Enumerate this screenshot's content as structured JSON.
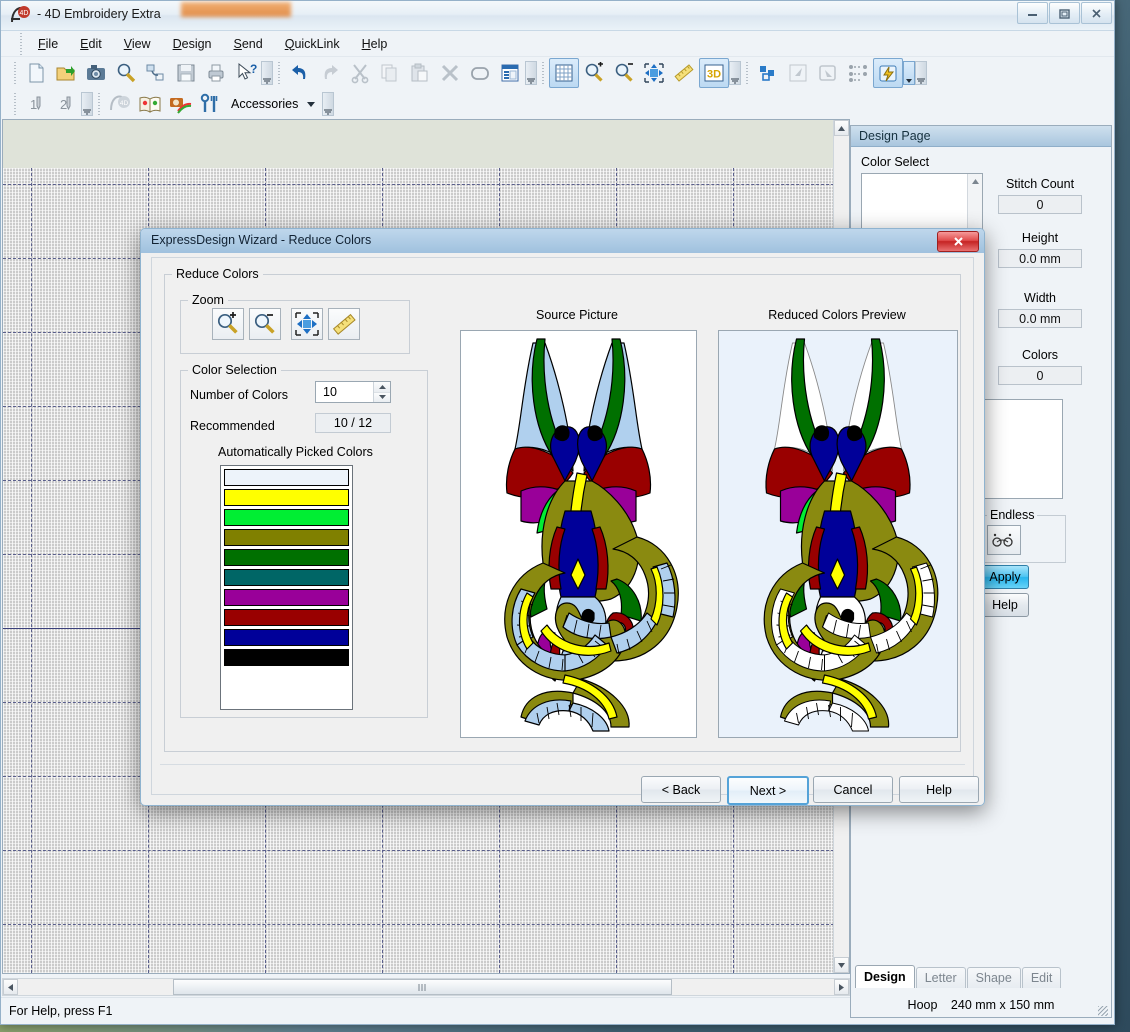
{
  "app": {
    "title": "- 4D Embroidery Extra",
    "logo_icon": "4d-logo-icon",
    "window_buttons": [
      {
        "name": "minimize-button",
        "icon": "minimize-icon"
      },
      {
        "name": "maximize-button",
        "icon": "maximize-icon"
      },
      {
        "name": "close-button",
        "icon": "close-icon"
      }
    ]
  },
  "menu": {
    "items": [
      {
        "label": "File",
        "accel": "F"
      },
      {
        "label": "Edit",
        "accel": "E"
      },
      {
        "label": "View",
        "accel": "V"
      },
      {
        "label": "Design",
        "accel": "D"
      },
      {
        "label": "Send",
        "accel": "S"
      },
      {
        "label": "QuickLink",
        "accel": "Q"
      },
      {
        "label": "Help",
        "accel": "H"
      }
    ]
  },
  "toolbar_main": {
    "buttons": [
      {
        "name": "new-icon",
        "tip": "New"
      },
      {
        "name": "open-folder-icon",
        "tip": "Open"
      },
      {
        "name": "camera-icon",
        "tip": "Insert from camera"
      },
      {
        "name": "magnifier-pencil-icon",
        "tip": "Express design"
      },
      {
        "name": "insert-design-icon",
        "tip": "Insert design"
      },
      {
        "name": "save-floppy-icon",
        "tip": "Save"
      },
      {
        "name": "print-icon",
        "tip": "Print"
      },
      {
        "name": "help-pointer-icon",
        "tip": "What's this"
      },
      {
        "name": "undo-icon",
        "tip": "Undo"
      },
      {
        "name": "redo-icon",
        "tip": "Redo"
      },
      {
        "name": "cut-scissors-icon",
        "tip": "Cut"
      },
      {
        "name": "copy-icon",
        "tip": "Copy"
      },
      {
        "name": "paste-icon",
        "tip": "Paste"
      },
      {
        "name": "delete-x-icon",
        "tip": "Delete"
      },
      {
        "name": "hoop-icon",
        "tip": "Change hoop"
      },
      {
        "name": "design-properties-icon",
        "tip": "Design properties"
      },
      {
        "name": "grid-icon",
        "tip": "Grid"
      },
      {
        "name": "zoom-in-icon",
        "tip": "Zoom in"
      },
      {
        "name": "zoom-out-icon",
        "tip": "Zoom out"
      },
      {
        "name": "zoom-fit-icon",
        "tip": "Zoom to fit"
      },
      {
        "name": "measure-ruler-icon",
        "tip": "Measure"
      },
      {
        "name": "3d-icon",
        "tip": "3D view"
      },
      {
        "name": "group-blocks-icon",
        "tip": "Group"
      },
      {
        "name": "select-arrow-icon",
        "tip": "Select"
      },
      {
        "name": "select-rect-icon",
        "tip": "Box select"
      },
      {
        "name": "sequence-icon",
        "tip": "Sequence"
      },
      {
        "name": "lightning-icon",
        "tip": "QuickLink"
      }
    ]
  },
  "toolbar_second": {
    "buttons": [
      {
        "name": "needle-1-icon",
        "label": "1"
      },
      {
        "name": "needle-2-icon",
        "label": "2"
      },
      {
        "name": "4d-suite-icon",
        "tip": "4D Suite"
      },
      {
        "name": "book-icon",
        "tip": "Design library"
      },
      {
        "name": "camera-rainbow-icon",
        "tip": "PhotoStitch"
      },
      {
        "name": "tools-icon",
        "tip": "Tools"
      }
    ],
    "accessories_label": "Accessories",
    "accessories_caret": "chevron-down-icon"
  },
  "design_page": {
    "header": "Design Page",
    "color_select_label": "Color Select",
    "fields": [
      {
        "label": "Stitch Count",
        "value": "0"
      },
      {
        "label": "Height",
        "value": "0.0 mm"
      },
      {
        "label": "Width",
        "value": "0.0 mm"
      },
      {
        "label": "Colors",
        "value": "0"
      }
    ],
    "endless_label": "Endless",
    "endless_icon": "endless-icon",
    "apply_label": "Apply",
    "help_label": "Help",
    "tabs": [
      {
        "label": "Design",
        "active": true
      },
      {
        "label": "Letter",
        "active": false
      },
      {
        "label": "Shape",
        "active": false
      },
      {
        "label": "Edit",
        "active": false
      }
    ],
    "hoop_label": "Hoop",
    "hoop_value": "240 mm x 150 mm"
  },
  "statusbar": {
    "text": "For Help, press F1"
  },
  "dialog": {
    "title": "ExpressDesign Wizard - Reduce Colors",
    "close_icon": "close-icon",
    "group_reduce_colors": "Reduce Colors",
    "group_zoom": "Zoom",
    "zoom_buttons": [
      {
        "name": "zoom-in-icon",
        "tip": "Zoom in"
      },
      {
        "name": "zoom-out-icon",
        "tip": "Zoom out"
      },
      {
        "name": "pan-move-icon",
        "tip": "Pan"
      },
      {
        "name": "ruler-icon",
        "tip": "Measure"
      }
    ],
    "group_color_selection": "Color Selection",
    "number_of_colors_label": "Number of Colors",
    "number_of_colors_value": "10",
    "recommended_label": "Recommended",
    "recommended_value": "10 / 12",
    "picked_colors_label": "Automatically Picked Colors",
    "picked_colors": [
      {
        "hex": "#edf3fa",
        "name": "near-white"
      },
      {
        "hex": "#ffff00",
        "name": "yellow"
      },
      {
        "hex": "#00ee33",
        "name": "bright-green"
      },
      {
        "hex": "#808000",
        "name": "olive"
      },
      {
        "hex": "#007000",
        "name": "dark-green"
      },
      {
        "hex": "#006666",
        "name": "teal"
      },
      {
        "hex": "#990099",
        "name": "purple"
      },
      {
        "hex": "#990000",
        "name": "dark-red"
      },
      {
        "hex": "#000099",
        "name": "navy"
      },
      {
        "hex": "#000000",
        "name": "black"
      }
    ],
    "source_picture_label": "Source Picture",
    "reduced_preview_label": "Reduced Colors Preview",
    "buttons": [
      {
        "label": "< Back",
        "name": "back-button",
        "default": false
      },
      {
        "label": "Next >",
        "name": "next-button",
        "default": true
      },
      {
        "label": "Cancel",
        "name": "cancel-button",
        "default": false
      },
      {
        "label": "Help",
        "name": "help-button",
        "default": false
      }
    ]
  },
  "artwork": {
    "description": "Two-headed dragon illustration",
    "source_background": "#ffffff",
    "preview_background": "#eaf2fb",
    "palette": {
      "body_olive": "#8a8a10",
      "belly_blue": "#b0d0ee",
      "belly_preview": "#ffffff",
      "wing_blue": "#b0d0ee",
      "wing_preview": "#ffffff",
      "wing_red": "#990000",
      "wing_purple": "#990099",
      "neck_green": "#007000",
      "accent_green": "#00ee33",
      "stripe_yellow": "#ffff00",
      "navy": "#000099",
      "black": "#000000"
    }
  }
}
